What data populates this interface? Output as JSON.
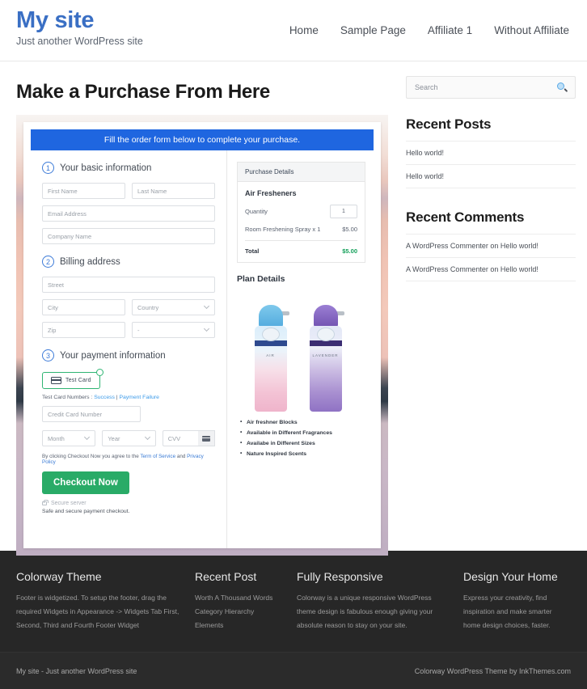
{
  "header": {
    "site_title": "My site",
    "tagline": "Just another WordPress site",
    "nav": [
      {
        "label": "Home"
      },
      {
        "label": "Sample Page"
      },
      {
        "label": "Affiliate 1"
      },
      {
        "label": "Without Affiliate"
      }
    ]
  },
  "page": {
    "title": "Make a Purchase From Here"
  },
  "checkout": {
    "banner": "Fill the order form below to complete your purchase.",
    "step1": {
      "number": "1",
      "title": "Your basic information",
      "first_name_placeholder": "First Name",
      "last_name_placeholder": "Last Name",
      "email_placeholder": "Email Address",
      "company_placeholder": "Company Name"
    },
    "step2": {
      "number": "2",
      "title": "Billing address",
      "street_placeholder": "Street",
      "city_placeholder": "City",
      "country_placeholder": "Country",
      "zip_placeholder": "Zip",
      "state_placeholder": "-"
    },
    "step3": {
      "number": "3",
      "title": "Your payment information",
      "test_card_label": "Test Card",
      "test_numbers_prefix": "Test Card Numbers :",
      "test_success_link": "Success",
      "test_separator": "|",
      "test_failure_link": "Payment Failure",
      "card_number_placeholder": "Credit Card Number",
      "month_placeholder": "Month",
      "year_placeholder": "Year",
      "cvv_placeholder": "CVV"
    },
    "legal_prefix": "By clicking Checkout Now you agree to the",
    "legal_tos": "Term of Service",
    "legal_and": "and",
    "legal_privacy": "Privacy Policy",
    "checkout_button": "Checkout Now",
    "secure_server": "Secure server",
    "secure_note": "Safe and secure payment checkout."
  },
  "purchase_details": {
    "heading": "Purchase Details",
    "product": "Air Fresheners",
    "quantity_label": "Quantity",
    "quantity_value": "1",
    "line_item": "Room Freshening Spray x 1",
    "line_amount": "$5.00",
    "total_label": "Total",
    "total_amount": "$5.00"
  },
  "plan_details": {
    "heading": "Plan Details",
    "bullets": [
      "Air freshner Blocks",
      "Available in Different Fragrances",
      "Availabe in Different Sizes",
      "Nature Inspired Scents"
    ]
  },
  "sidebar": {
    "search_placeholder": "Search",
    "recent_posts_title": "Recent Posts",
    "recent_posts": [
      "Hello world!",
      "Hello world!"
    ],
    "recent_comments_title": "Recent Comments",
    "recent_comments": [
      "A WordPress Commenter on Hello world!",
      "A WordPress Commenter on Hello world!"
    ]
  },
  "footer": {
    "columns": [
      {
        "title": "Colorway Theme",
        "text": "Footer is widgetized. To setup the footer, drag the required Widgets in Appearance -> Widgets Tab First, Second, Third and Fourth Footer Widget"
      },
      {
        "title": "Recent Post",
        "items": [
          "Worth A Thousand Words",
          "Category Hierarchy",
          "Elements"
        ]
      },
      {
        "title": "Fully Responsive",
        "text": "Colorway is a unique responsive WordPress theme design is fabulous enough giving your absolute reason to stay on your site."
      },
      {
        "title": "Design Your Home",
        "text": "Express your creativity, find inspiration and make smarter home design choices, faster."
      }
    ],
    "copyright_left": "My site - Just another WordPress site",
    "copyright_right": "Colorway WordPress Theme by InkThemes.com"
  },
  "colors": {
    "brand_blue": "#3a6fc4",
    "banner_blue": "#1f66e0",
    "success_green": "#29ab67",
    "total_green": "#14a05a",
    "footer_bg": "#272727"
  }
}
